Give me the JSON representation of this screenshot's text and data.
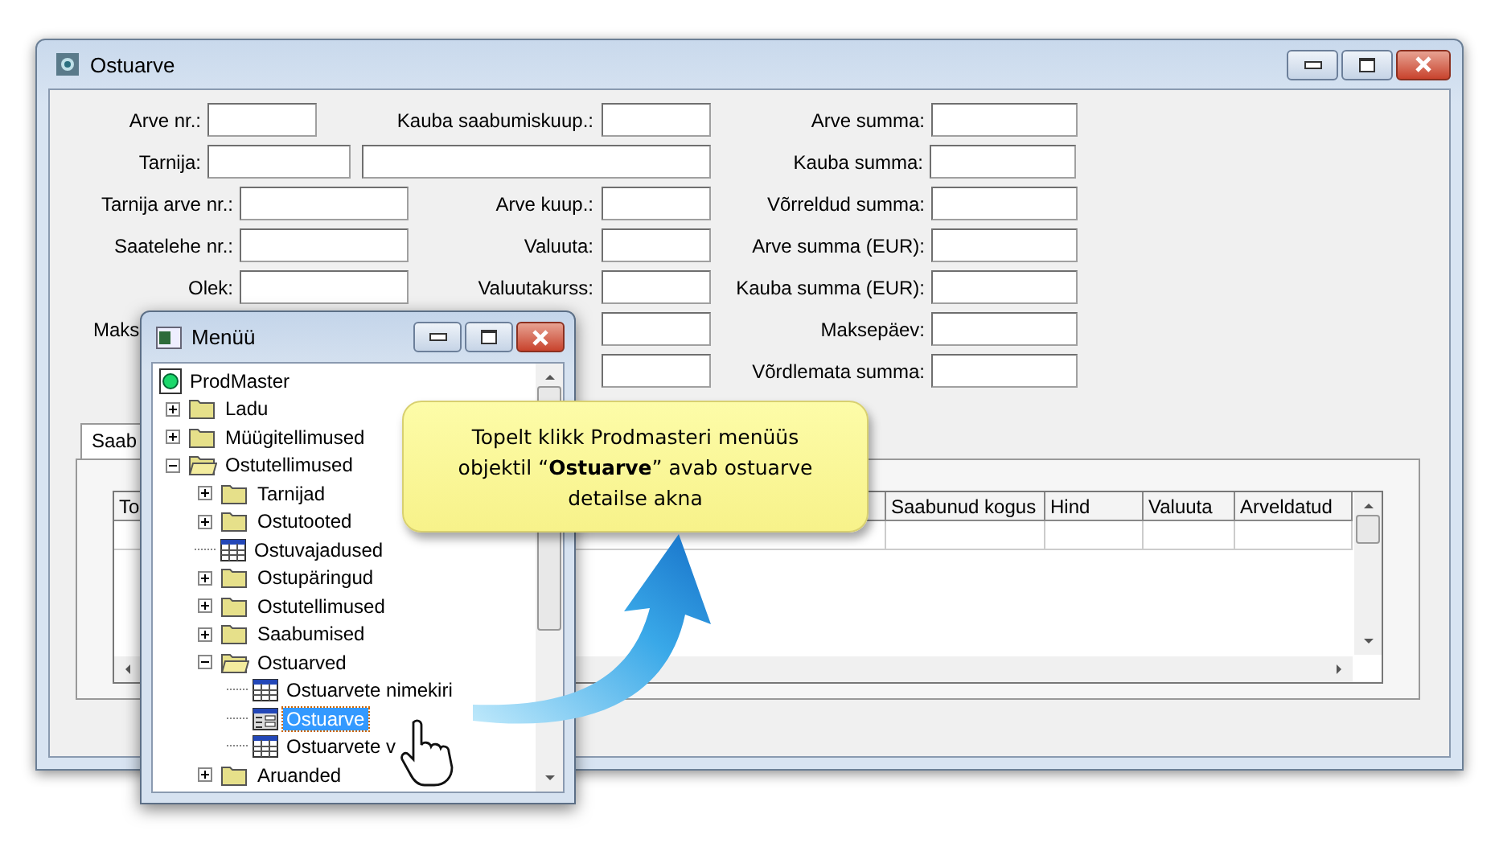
{
  "window": {
    "title": "Ostuarve"
  },
  "form": {
    "rows": [
      {
        "left": {
          "kind": "short",
          "label": "Arve nr.:"
        },
        "middle": {
          "kind": "labeled",
          "label": "Kauba saabumiskuup.:"
        },
        "right": {
          "label": "Arve summa:"
        }
      },
      {
        "left": {
          "kind": "pair",
          "label": "Tarnija:"
        },
        "right": {
          "label": "Kauba summa:"
        }
      },
      {
        "left": {
          "kind": "wide",
          "label": "Tarnija arve nr.:"
        },
        "middle": {
          "kind": "labeled",
          "label": "Arve kuup.:"
        },
        "right": {
          "label": "Võrreldud summa:"
        }
      },
      {
        "left": {
          "kind": "wide",
          "label": "Saatelehe nr.:"
        },
        "middle": {
          "kind": "labeled",
          "label": "Valuuta:"
        },
        "right": {
          "label": "Arve summa (EUR):"
        }
      },
      {
        "left": {
          "kind": "wide",
          "label": "Olek:"
        },
        "middle": {
          "kind": "labeled",
          "label": "Valuutakurss:"
        },
        "right": {
          "label": "Kauba summa (EUR):"
        }
      },
      {
        "left": {
          "kind": "cut",
          "label": "Maks"
        },
        "middle": {
          "kind": "field"
        },
        "right": {
          "label": "Maksepäev:"
        }
      },
      {
        "middle": {
          "kind": "field"
        },
        "right": {
          "label": "Võrdlemata summa:"
        }
      }
    ]
  },
  "tabs": [
    {
      "label": "Saab",
      "selected": true
    }
  ],
  "table": {
    "columns": [
      {
        "label": "To"
      },
      {
        "label": "Saabunud kogus"
      },
      {
        "label": "Hind"
      },
      {
        "label": "Valuuta"
      },
      {
        "label": "Arveldatud"
      }
    ]
  },
  "menu_window": {
    "title": "Menüü",
    "tree": [
      {
        "label": "ProdMaster",
        "kind": "root",
        "selected": false,
        "children": [
          {
            "label": "Ladu",
            "kind": "folder",
            "expanded": false,
            "selected": false
          },
          {
            "label": "Müügitellimused",
            "kind": "folder",
            "expanded": false,
            "selected": false
          },
          {
            "label": "Ostutellimused",
            "kind": "folder",
            "expanded": true,
            "selected": false,
            "children": [
              {
                "label": "Tarnijad",
                "kind": "folder",
                "expanded": false,
                "selected": false
              },
              {
                "label": "Ostutooted",
                "kind": "folder",
                "expanded": false,
                "selected": false
              },
              {
                "label": "Ostuvajadused",
                "kind": "table",
                "selected": false
              },
              {
                "label": "Ostupäringud",
                "kind": "folder",
                "expanded": false,
                "selected": false
              },
              {
                "label": "Ostutellimused",
                "kind": "folder",
                "expanded": false,
                "selected": false
              },
              {
                "label": "Saabumised",
                "kind": "folder",
                "expanded": false,
                "selected": false
              },
              {
                "label": "Ostuarved",
                "kind": "folder",
                "expanded": true,
                "selected": false,
                "children": [
                  {
                    "label": "Ostuarvete nimekiri",
                    "kind": "table",
                    "selected": false
                  },
                  {
                    "label": "Ostuarve",
                    "kind": "form",
                    "selected": true
                  },
                  {
                    "label": "Ostuarvete v",
                    "kind": "table",
                    "selected": false
                  }
                ]
              },
              {
                "label": "Aruanded",
                "kind": "folder",
                "expanded": false,
                "selected": false
              }
            ]
          }
        ]
      }
    ]
  },
  "callout": {
    "lines": [
      "Topelt klikk Prodmasteri menüüs",
      "objektil “**Ostuarve**” avab ostuarve",
      "detailse akna"
    ]
  }
}
